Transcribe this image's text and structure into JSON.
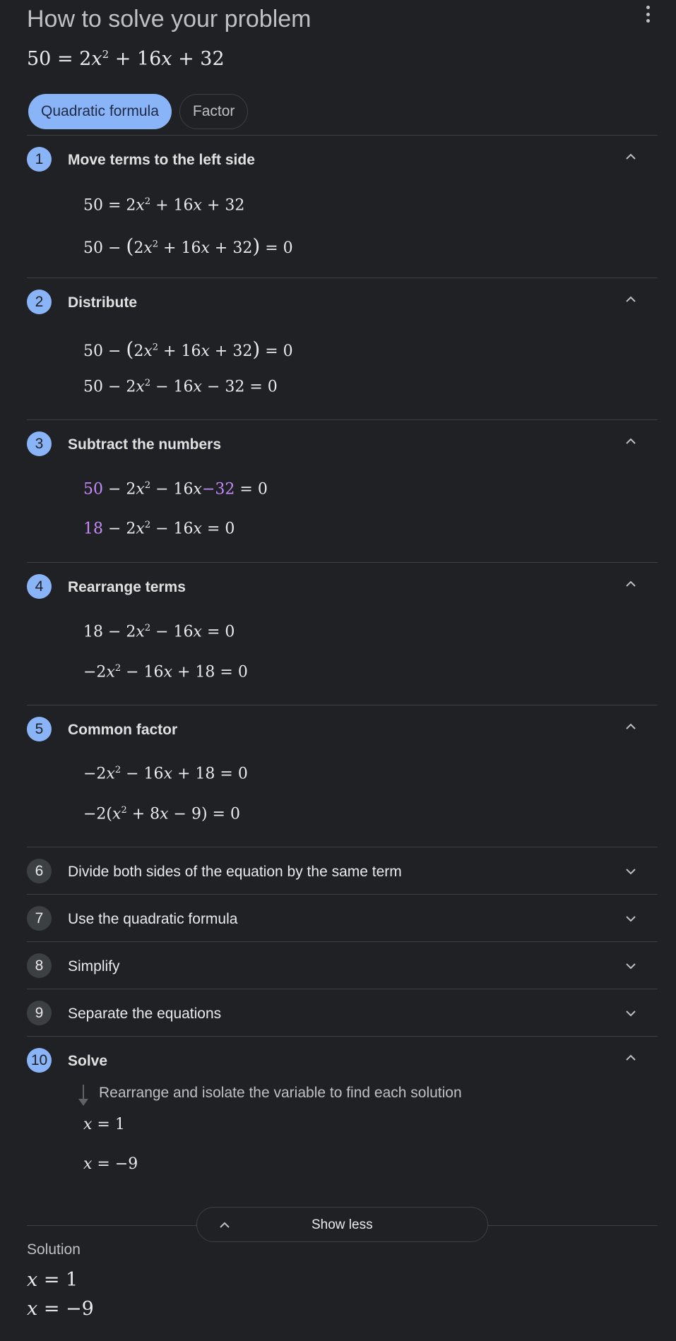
{
  "header": {
    "title": "How to solve your problem"
  },
  "problem": {
    "lhs": "50",
    "mid": " = 2",
    "var": "x",
    "exp": "2",
    "rest": " + 16",
    "var2": "x",
    "end": " + 32"
  },
  "tabs": [
    {
      "label": "Quadratic formula",
      "active": true
    },
    {
      "label": "Factor",
      "active": false
    }
  ],
  "steps": [
    {
      "num": "1",
      "label": "Move terms to the left side",
      "expanded": true
    },
    {
      "num": "2",
      "label": "Distribute",
      "expanded": true
    },
    {
      "num": "3",
      "label": "Subtract the numbers",
      "expanded": true
    },
    {
      "num": "4",
      "label": "Rearrange terms",
      "expanded": true
    },
    {
      "num": "5",
      "label": "Common factor",
      "expanded": true
    },
    {
      "num": "6",
      "label": "Divide both sides of the equation by the same term",
      "expanded": false
    },
    {
      "num": "7",
      "label": "Use the quadratic formula",
      "expanded": false
    },
    {
      "num": "8",
      "label": "Simplify",
      "expanded": false
    },
    {
      "num": "9",
      "label": "Separate the equations",
      "expanded": false
    },
    {
      "num": "10",
      "label": "Solve",
      "expanded": true,
      "note": "Rearrange and isolate the variable to find each solution"
    }
  ],
  "show_less": {
    "label": "Show less"
  },
  "solution": {
    "label": "Solution",
    "values": [
      "x = 1",
      "x = −9"
    ]
  },
  "colors": {
    "accent": "#8ab4f8",
    "highlight": "#c58af9",
    "background": "#202124"
  }
}
